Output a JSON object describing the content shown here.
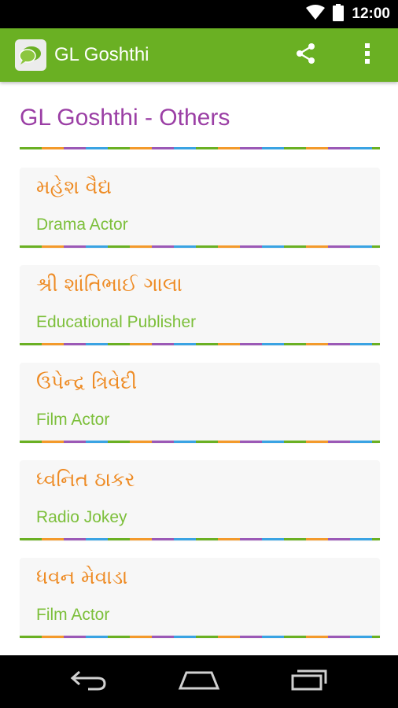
{
  "status_bar": {
    "time": "12:00",
    "icons": [
      "wifi-icon",
      "battery-icon"
    ]
  },
  "app_bar": {
    "title": "GL Goshthi",
    "logo_icon": "speech-bubble-logo-icon",
    "actions": [
      "share-icon",
      "overflow-menu-icon"
    ],
    "color": "#6ab023"
  },
  "page": {
    "title": "GL Goshthi - Others",
    "title_color": "#9b3fa5",
    "divider_colors": [
      "#6ab023",
      "#f39a2b",
      "#9b59b6",
      "#3aa3e3"
    ]
  },
  "items": [
    {
      "name": "મહેશ વૈદ્ય",
      "role": "Drama Actor"
    },
    {
      "name": "શ્રી શાંતિભાઈ ગાલા",
      "role": "Educational Publisher"
    },
    {
      "name": "ઉપેન્દ્ર ત્રિવેદી",
      "role": "Film Actor"
    },
    {
      "name": "ધ્વનિત ઠાકર",
      "role": "Radio Jokey"
    },
    {
      "name": "ધવન મેવાડા",
      "role": "Film Actor"
    }
  ],
  "item_colors": {
    "name": "#ee8b24",
    "role": "#7cbf3a"
  },
  "nav_bar": {
    "buttons": [
      "back-icon",
      "home-icon",
      "recents-icon"
    ]
  }
}
